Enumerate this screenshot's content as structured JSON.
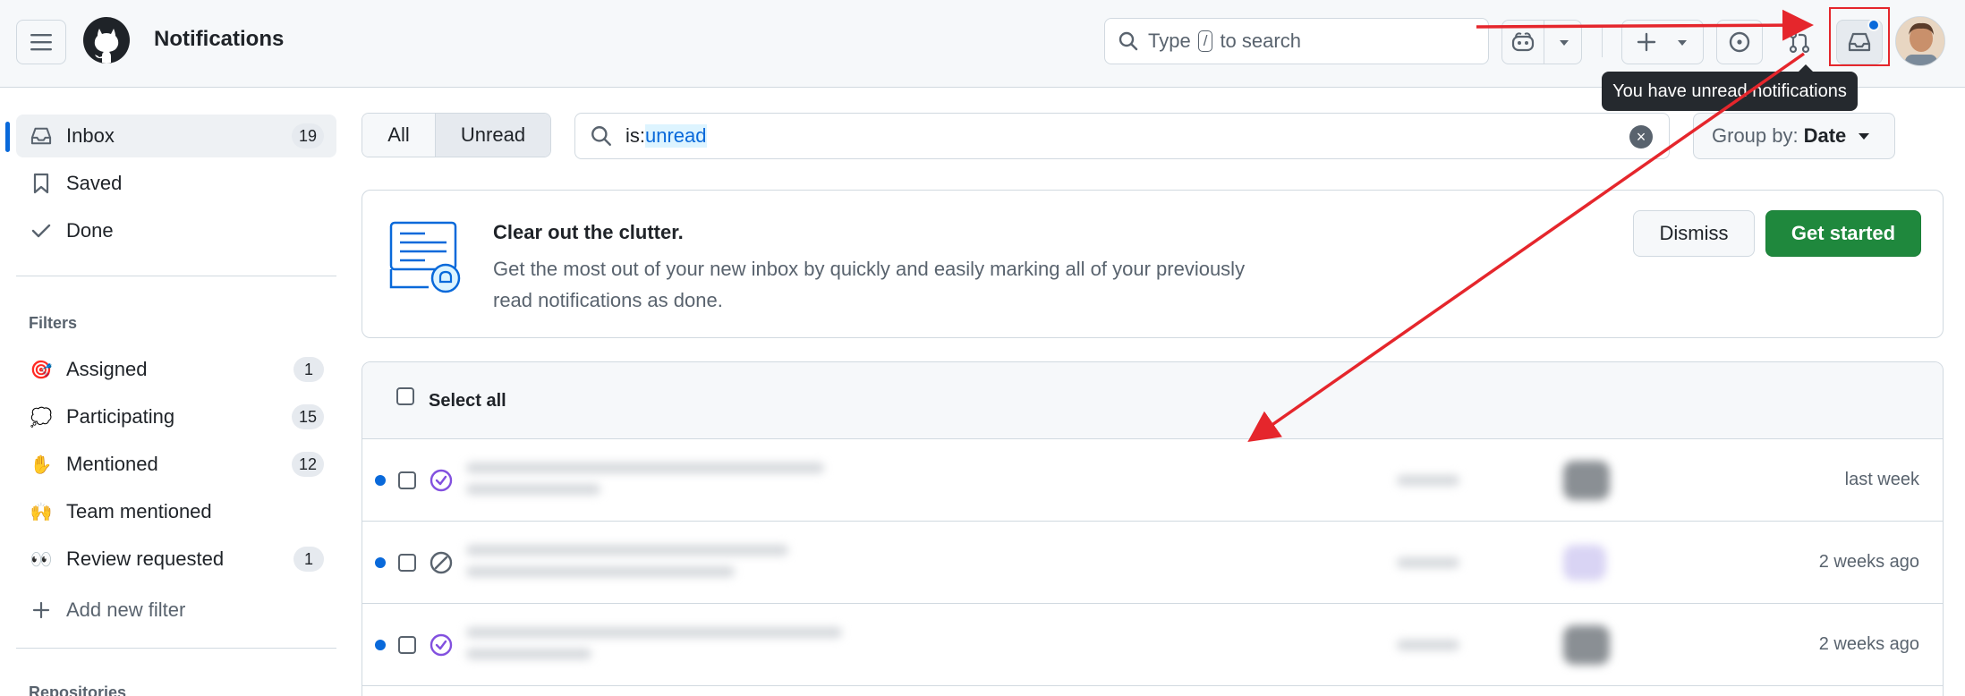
{
  "header": {
    "app_title": "Notifications",
    "search": {
      "prefix": "Type",
      "kbd": "/",
      "suffix": "to search"
    },
    "tooltip": "You have unread notifications",
    "colors": {
      "unread_dot": "#0969da",
      "annotation_red": "#e5262c"
    }
  },
  "sidebar": {
    "nav": [
      {
        "label": "Inbox",
        "count": "19",
        "icon": "inbox-icon",
        "active": true
      },
      {
        "label": "Saved",
        "icon": "bookmark-icon"
      },
      {
        "label": "Done",
        "icon": "check-icon"
      }
    ],
    "filters_label": "Filters",
    "filters": [
      {
        "label": "Assigned",
        "count": "1",
        "emoji": "🎯"
      },
      {
        "label": "Participating",
        "count": "15",
        "emoji": "💭"
      },
      {
        "label": "Mentioned",
        "count": "12",
        "emoji": "✋"
      },
      {
        "label": "Team mentioned",
        "emoji": "🙌"
      },
      {
        "label": "Review requested",
        "count": "1",
        "emoji": "👀"
      }
    ],
    "add_filter": "Add new filter",
    "repositories_label": "Repositories"
  },
  "toolbar": {
    "tab_all": "All",
    "tab_unread": "Unread",
    "query_prefix": "is:",
    "query_value": "unread",
    "group_by_label": "Group by:",
    "group_by_value": "Date"
  },
  "banner": {
    "title": "Clear out the clutter.",
    "body_line1": "Get the most out of your new inbox by quickly and easily marking all of your previously",
    "body_line2": "read notifications as done.",
    "dismiss": "Dismiss",
    "get_started": "Get started",
    "accent": "#1f883d"
  },
  "list": {
    "select_all": "Select all",
    "rows": [
      {
        "time": "last week",
        "status_icon": "issue-closed-icon"
      },
      {
        "time": "2 weeks ago",
        "status_icon": "skip-icon"
      },
      {
        "time": "2 weeks ago",
        "status_icon": "issue-closed-icon"
      }
    ]
  }
}
